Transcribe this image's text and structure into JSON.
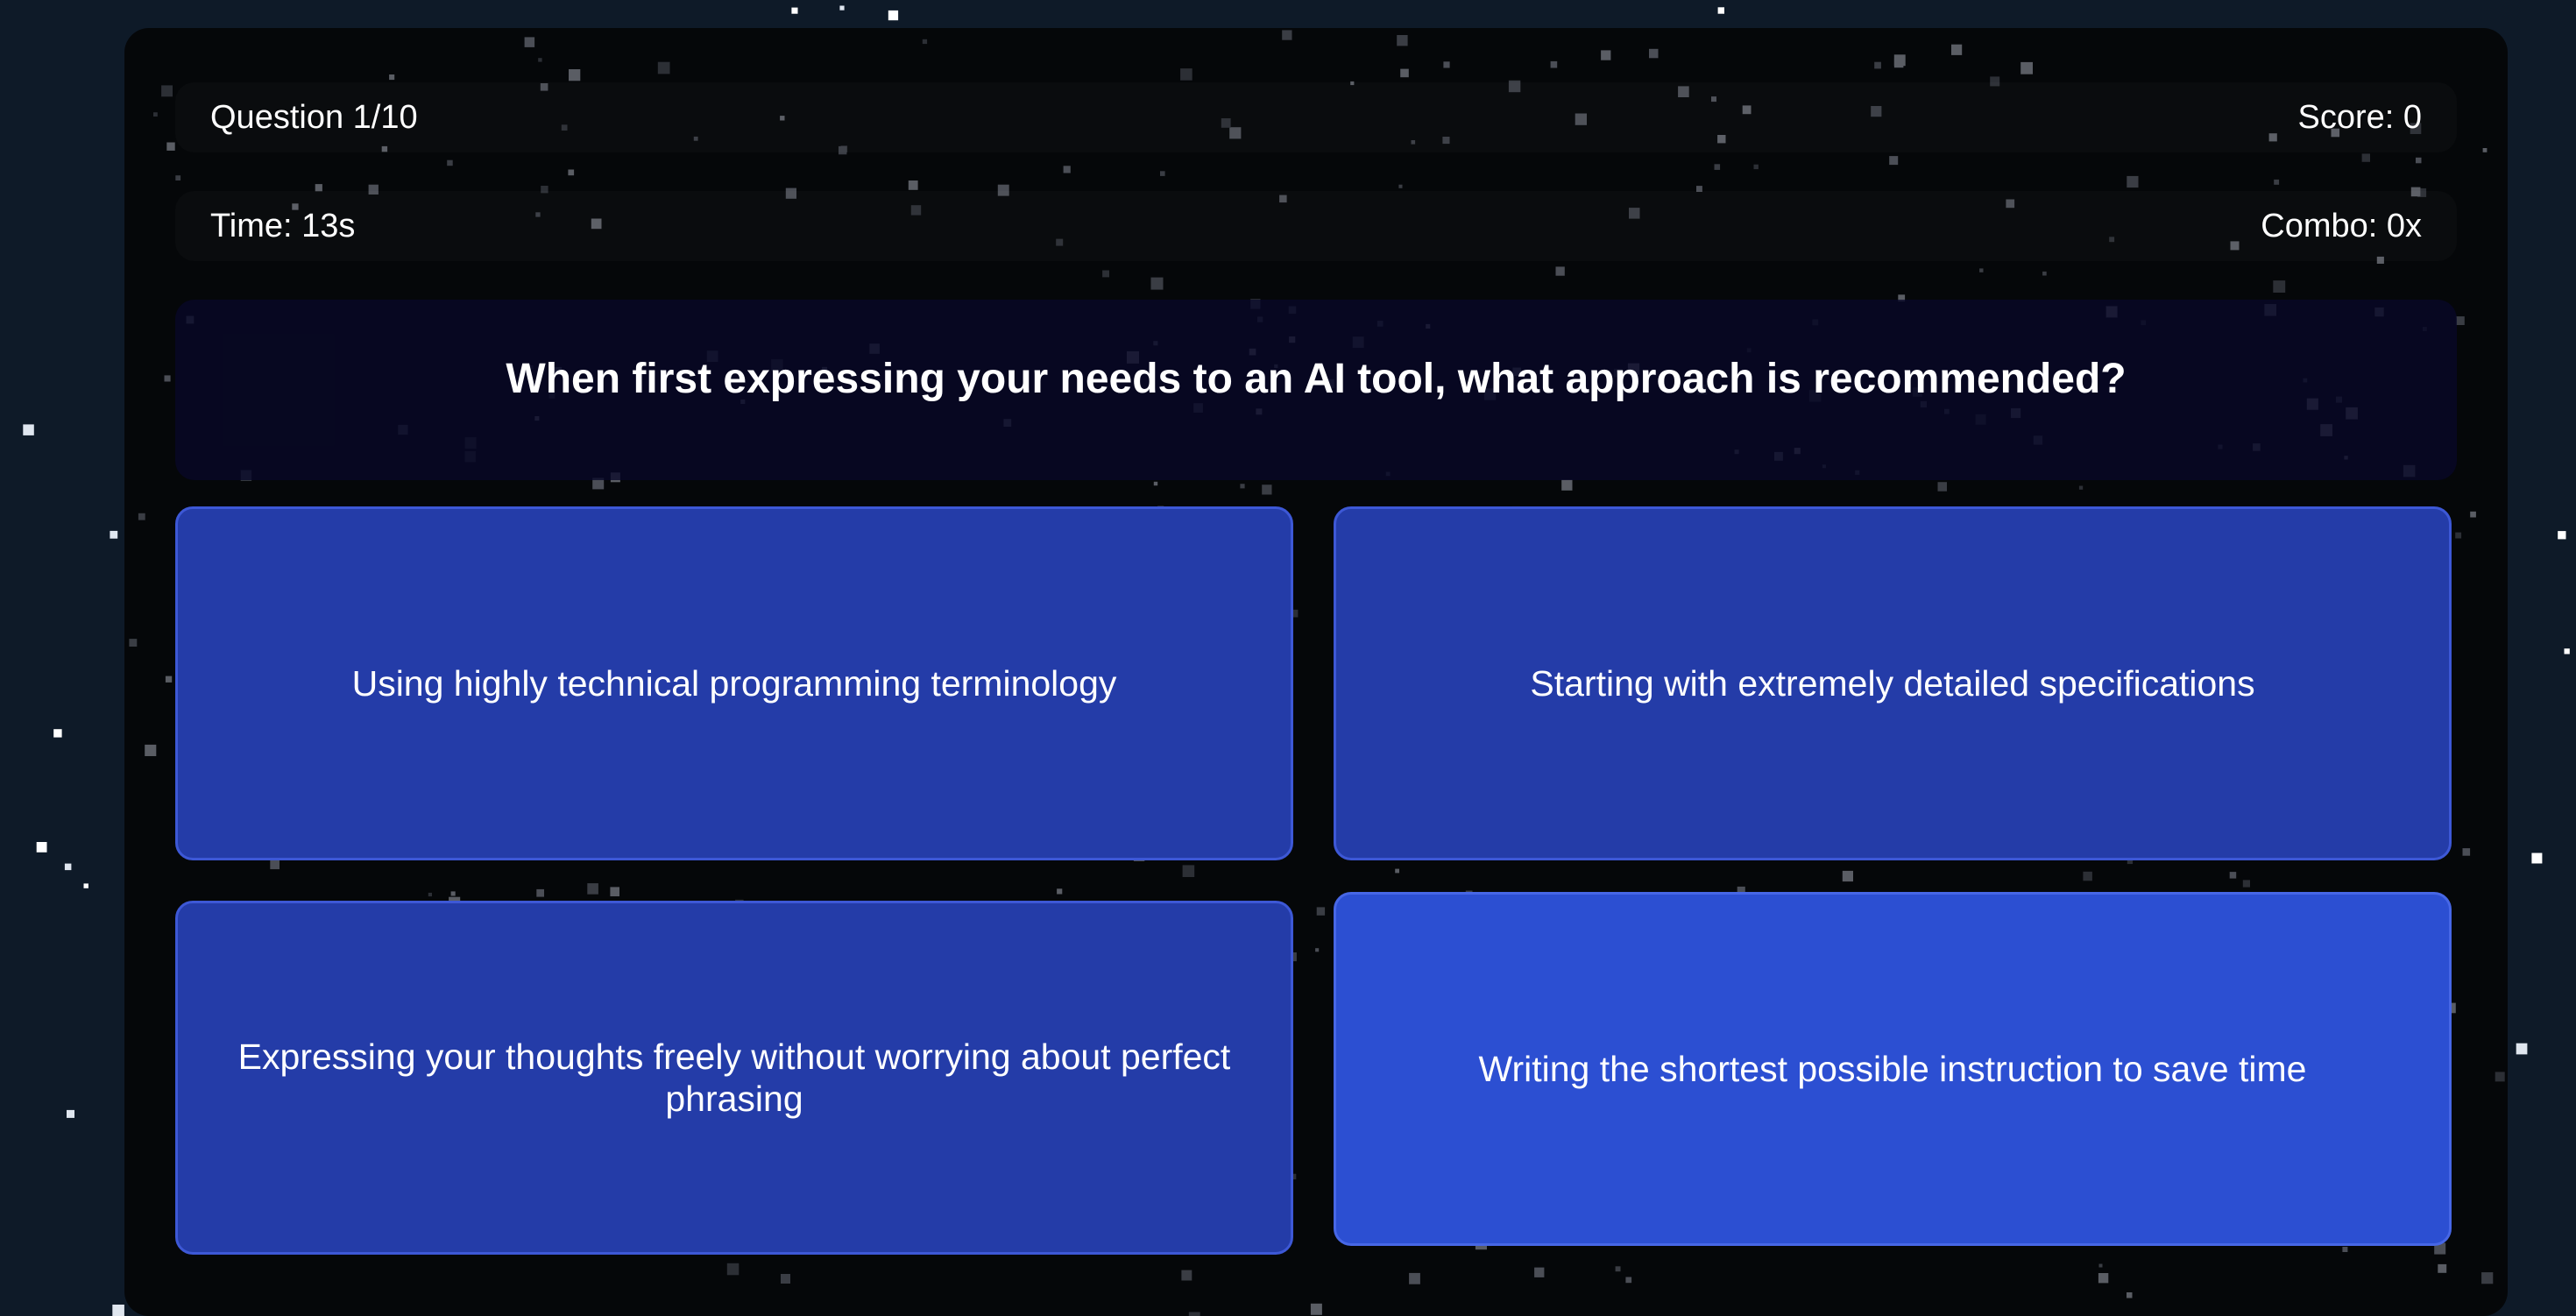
{
  "hud": {
    "question_counter": "Question 1/10",
    "score": "Score: 0",
    "timer": "Time: 13s",
    "combo": "Combo: 0x"
  },
  "question": {
    "text": "When first expressing your needs to an AI tool, what approach is recommended?"
  },
  "answers": [
    {
      "label": "Using highly technical programming terminology"
    },
    {
      "label": "Starting with extremely detailed specifications"
    },
    {
      "label": "Expressing your thoughts freely without worrying about perfect phrasing"
    },
    {
      "label": "Writing the shortest possible instruction to save time"
    }
  ],
  "colors": {
    "page_background": "#0e1a28",
    "panel_background": "#050709",
    "answer_button": "#243ca8",
    "answer_button_hover": "#2c4fd2",
    "answer_border": "#3d58d6"
  }
}
